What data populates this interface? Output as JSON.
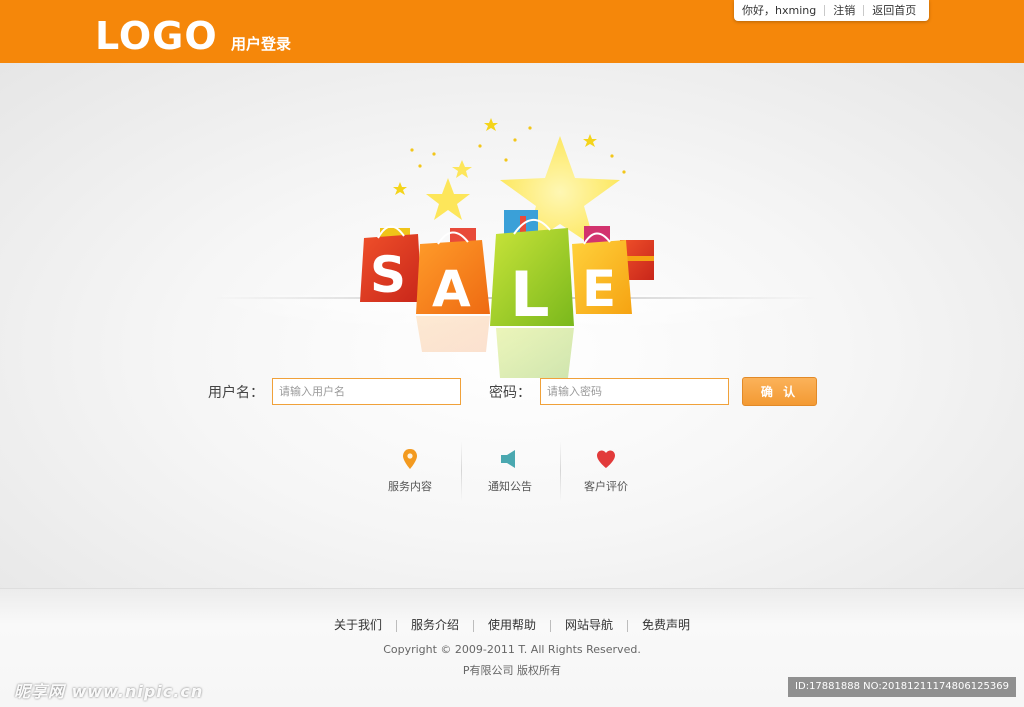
{
  "header": {
    "logo": "LOGO",
    "subtitle": "用户登录",
    "greeting": "你好，hxming",
    "logout": "注销",
    "home": "返回首页"
  },
  "banner": {
    "letters": [
      "S",
      "A",
      "L",
      "E"
    ],
    "icon": "sale-shopping-bags-illustration"
  },
  "login": {
    "username_label": "用户名：",
    "username_placeholder": "请输入用户名",
    "password_label": "密码：",
    "password_placeholder": "请输入密码",
    "confirm_label": "确 认"
  },
  "features": [
    {
      "label": "服务内容",
      "icon": "map-pin-icon",
      "color": "#f39a1f"
    },
    {
      "label": "通知公告",
      "icon": "speaker-icon",
      "color": "#4aa8b0"
    },
    {
      "label": "客户评价",
      "icon": "heart-icon",
      "color": "#e23b3b"
    }
  ],
  "footer": {
    "links": [
      "关于我们",
      "服务介绍",
      "使用帮助",
      "网站导航",
      "免费声明"
    ],
    "copyright": "Copyright © 2009-2011 T. All Rights Reserved.",
    "company": "P有限公司  版权所有"
  },
  "watermark": {
    "left": "昵享网 www.nipic.cn",
    "right": "ID:17881888 NO:20181211174806125369"
  },
  "colors": {
    "accent": "#f5870a",
    "field_border": "#f0a13a"
  }
}
